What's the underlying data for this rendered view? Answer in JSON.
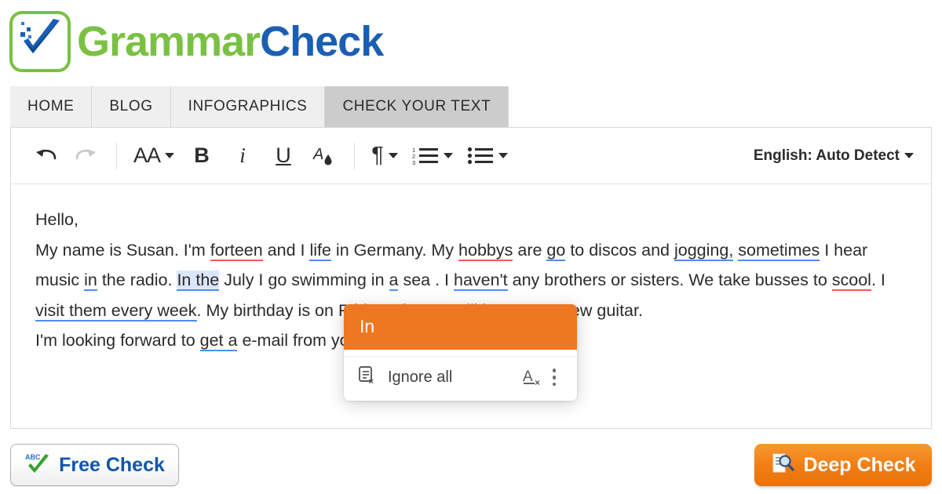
{
  "brand": {
    "logo_icon": "checkmark-logo-icon",
    "name_part1": "Grammar",
    "name_part2": "Check",
    "green": "#7ac143",
    "blue": "#1a5fb4"
  },
  "nav": {
    "tabs": [
      {
        "label": "HOME",
        "active": false
      },
      {
        "label": "BLOG",
        "active": false
      },
      {
        "label": "INFOGRAPHICS",
        "active": false
      },
      {
        "label": "CHECK YOUR TEXT",
        "active": true
      }
    ]
  },
  "toolbar": {
    "undo_icon": "undo-icon",
    "redo_icon": "redo-icon",
    "font_size_label": "AA",
    "bold_label": "B",
    "italic_label": "i",
    "underline_label": "U",
    "text_color_icon": "text-color-droplet-icon",
    "paragraph_label": "¶",
    "numbered_list_icon": "numbered-list-icon",
    "bulleted_list_icon": "bulleted-list-icon",
    "language_label": "English: Auto Detect",
    "caret_icon": "chevron-down-icon"
  },
  "document": {
    "lines": [
      "Hello,",
      "My name is Susan. I'm forteen and I life in Germany. My hobbys are go to discos and jogging, sometimes I hear music in the radio. In the July I go swimming in a sea . I haven't any brothers or sisters. We take busses to scool. I visit them every week. My birthday is on Friday. I hope I will become a new guitar.",
      "I'm looking forward to get a e-mail from you."
    ],
    "text_runs": {
      "l1": "Hello,",
      "l2a": "My name is Susan. I'm ",
      "l2b": "forteen",
      "l2c": " and I ",
      "l2d": "life",
      "l2e": " in Germany. My ",
      "l2f": "hobbys",
      "l2g": " are ",
      "l2h": "go",
      "l2i": " to discos and ",
      "l2j": "jogging,",
      "l3a": "sometimes",
      "l3b": " I hear music ",
      "l3c": "in",
      "l3d": " the radio. ",
      "l3e": "In the",
      "l3f": " July I go swimming in ",
      "l3g": "a",
      "l3h": " sea . I ",
      "l3i": "haven't",
      "l3j": " any brothers or",
      "l4a": "sisters. We take busses to ",
      "l4b": "scool",
      "l4c": ". I ",
      "l4d": "visit them every week",
      "l4e": ". My birthday is on Friday. I hope I",
      "l5a": "will become a new guitar.",
      "l6a": "I'm looking forward to ",
      "l6b": "get a",
      "l6c": " e-mail from you."
    },
    "error_colors": {
      "spelling": "#f05a52",
      "grammar": "#4d8df2",
      "active_highlight": "#dbe6f8"
    }
  },
  "suggestion_popup": {
    "suggestion": "In",
    "ignore_label": "Ignore all",
    "ignore_icon": "ignore-all-icon",
    "clear_formatting_icon": "clear-formatting-icon",
    "more_icon": "kebab-menu-icon",
    "accent_color": "#ee7722"
  },
  "footer": {
    "free_check_label": "Free Check",
    "free_check_icon": "abc-checkmark-icon",
    "free_check_color": "#1155aa",
    "deep_check_label": "Deep Check",
    "deep_check_icon": "document-magnifier-icon",
    "deep_check_color": "#f07c14"
  }
}
